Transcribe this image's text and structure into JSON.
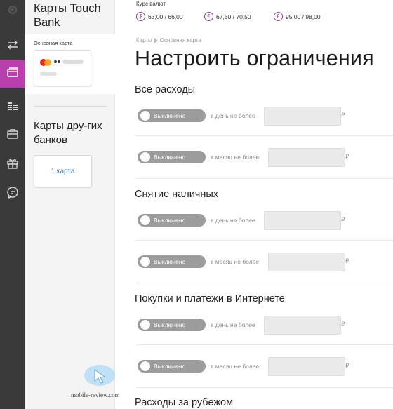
{
  "rail": {
    "items": [
      {
        "icon": "gear-icon",
        "active": false
      },
      {
        "icon": "transfer-arrows-icon",
        "active": false
      },
      {
        "icon": "cards-icon",
        "active": true
      },
      {
        "icon": "coins-stack-icon",
        "active": false
      },
      {
        "icon": "briefcase-icon",
        "active": false
      },
      {
        "icon": "gift-icon",
        "active": false
      },
      {
        "icon": "chat-bubble-icon",
        "active": false
      }
    ],
    "active_color": "#b83fae"
  },
  "panel": {
    "title": "Карты Touch Bank",
    "main_card_label": "Основная карта",
    "other_banks_title": "Карты дру-гих банков",
    "other_banks_button": "1 карта"
  },
  "watermark": {
    "text": "mobile-review.com"
  },
  "header": {
    "rates_title": "Курс валют",
    "rates": [
      {
        "symbol": "$",
        "value": "63,00 / 66,00"
      },
      {
        "symbol": "€",
        "value": "67,50 / 70,50"
      },
      {
        "symbol": "£",
        "value": "95,00 / 98,00"
      }
    ]
  },
  "breadcrumb": {
    "root": "Карты",
    "current": "Основная карта"
  },
  "page_title": "Настроить ограничения",
  "sections": [
    {
      "title": "Все расходы",
      "rows": [
        {
          "toggle": "Выключено",
          "label": "в день не более",
          "currency": "₽"
        },
        {
          "toggle": "Выключено",
          "label": "в месяц не более",
          "currency": "₽"
        }
      ]
    },
    {
      "title": "Снятие наличных",
      "rows": [
        {
          "toggle": "Выключено",
          "label": "в день не более",
          "currency": "₽"
        },
        {
          "toggle": "Выключено",
          "label": "в месяц не более",
          "currency": "₽"
        }
      ]
    },
    {
      "title": "Покупки и платежи в Интернете",
      "rows": [
        {
          "toggle": "Выключено",
          "label": "в день не более",
          "currency": "₽"
        },
        {
          "toggle": "Выключено",
          "label": "в месяц не более",
          "currency": "₽"
        }
      ]
    },
    {
      "title": "Расходы за рубежом",
      "rows": []
    }
  ]
}
